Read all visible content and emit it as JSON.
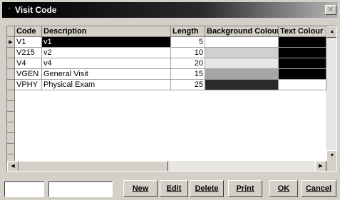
{
  "window": {
    "title": "Visit Code"
  },
  "grid": {
    "headers": [
      "Code",
      "Description",
      "Length",
      "Background Colour",
      "Text Colour"
    ],
    "rows": [
      {
        "code": "V1",
        "description": "v1",
        "length": "5",
        "bg": "#ffffff",
        "text": "#000000",
        "selected": true
      },
      {
        "code": "V215",
        "description": "v2",
        "length": "10",
        "bg": "#d0d0d0",
        "text": "#000000"
      },
      {
        "code": "V4",
        "description": "v4",
        "length": "20",
        "bg": "#e6e6e6",
        "text": "#000000"
      },
      {
        "code": "VGEN",
        "description": "General Visit",
        "length": "15",
        "bg": "#a5a5a5",
        "text": "#000000"
      },
      {
        "code": "VPHY",
        "description": "Physical Exam",
        "length": "25",
        "bg": "#2a2a2a",
        "text": ""
      }
    ],
    "current_row_marker": "▶"
  },
  "buttons": {
    "new": "New",
    "edit": "Edit",
    "delete": "Delete",
    "print": "Print",
    "ok": "OK",
    "cancel": "Cancel"
  },
  "fields": {
    "field1": "",
    "field2": ""
  },
  "icons": {
    "close": "close-icon",
    "scroll_up": "up-arrow-icon",
    "scroll_down": "down-arrow-icon",
    "scroll_left": "left-arrow-icon",
    "scroll_right": "right-arrow-icon"
  }
}
